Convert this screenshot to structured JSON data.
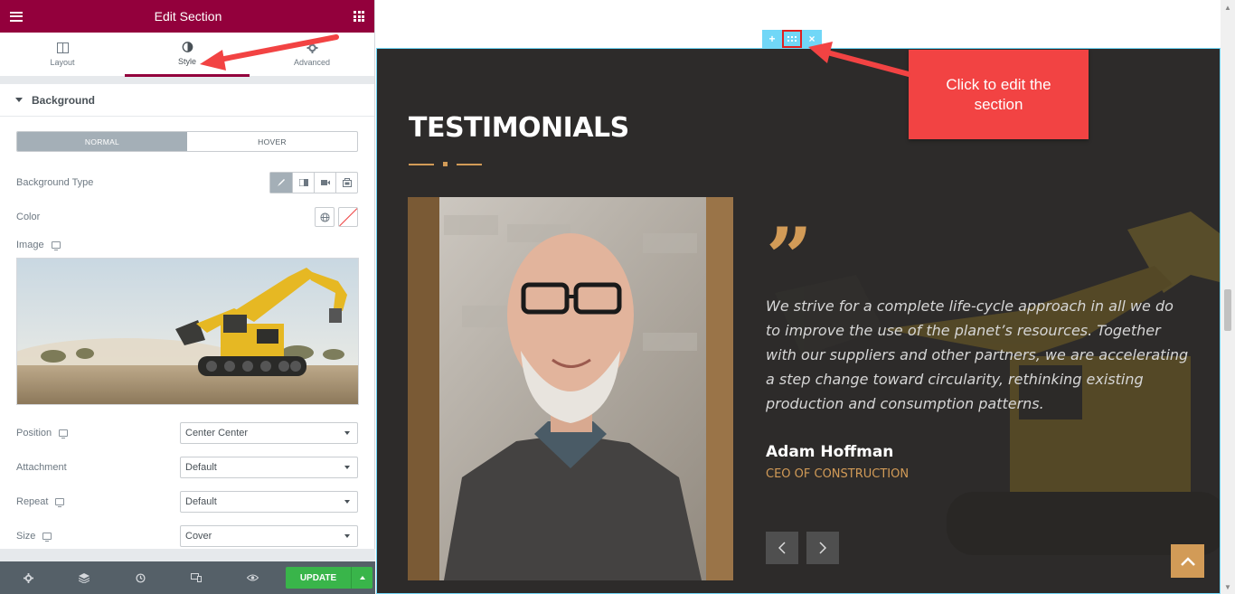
{
  "panel": {
    "title": "Edit Section",
    "accent": "#93003c",
    "tabs": [
      {
        "label": "Layout",
        "icon": "layout-icon",
        "active": false
      },
      {
        "label": "Style",
        "icon": "half-circle-icon",
        "active": true
      },
      {
        "label": "Advanced",
        "icon": "gear-icon",
        "active": false
      }
    ],
    "section_title": "Background",
    "state_tabs": {
      "normal": "NORMAL",
      "hover": "HOVER",
      "selected": "NORMAL"
    },
    "background_type_label": "Background Type",
    "background_type_options": [
      "brush-icon",
      "gradient-icon",
      "video-icon",
      "slideshow-icon"
    ],
    "color_label": "Color",
    "image_label": "Image",
    "position": {
      "label": "Position",
      "value": "Center Center"
    },
    "attachment": {
      "label": "Attachment",
      "value": "Default"
    },
    "repeat": {
      "label": "Repeat",
      "value": "Default"
    },
    "size": {
      "label": "Size",
      "value": "Cover"
    },
    "footer": {
      "update_label": "UPDATE",
      "update_color": "#39b54a"
    }
  },
  "preview": {
    "heading": "TESTIMONIALS",
    "quote_mark": "”",
    "quote": "We strive for a complete life-cycle approach in all we do to improve the use of the planet’s resources. Together with our suppliers and other partners, we are accelerating a step change toward circularity, rethinking existing production and consumption patterns.",
    "author_name": "Adam Hoffman",
    "author_role": "CEO OF CONSTRUCTION",
    "accent": "#d29b57",
    "handle_color": "#71d7f7"
  },
  "callout": {
    "text": "Click to edit the section",
    "color": "#f24343"
  }
}
